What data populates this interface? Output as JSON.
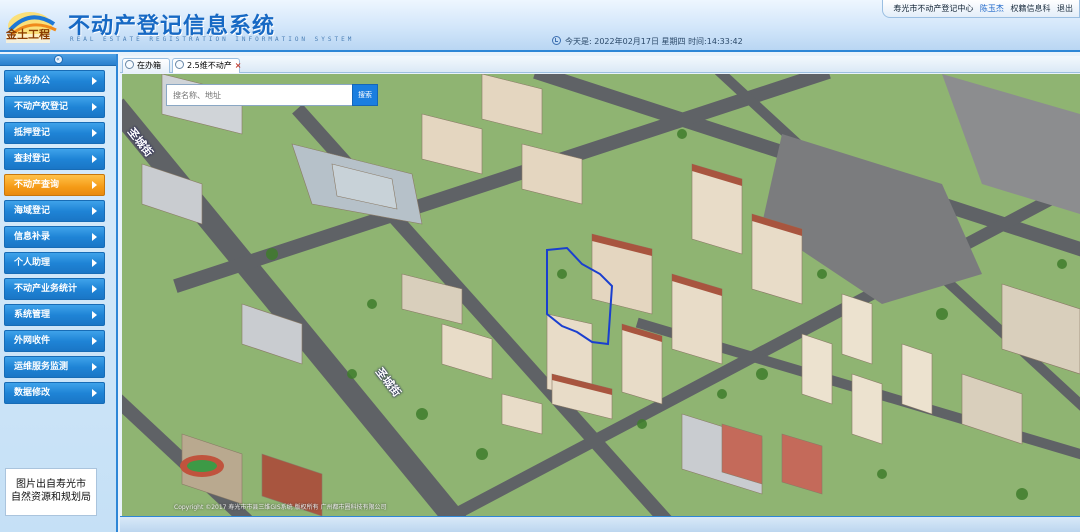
{
  "header": {
    "logo_text": "金土工程",
    "title": "不动产登记信息系统",
    "subtitle": "REAL ESTATE REGISTRATION INFORMATION SYSTEM",
    "center_name": "寿光市不动产登记中心",
    "user_name": "陈玉杰",
    "link_dept": "权籍信息科",
    "link_exit": "退出",
    "date_label": "今天是:",
    "date_value": "2022年02月17日",
    "weekday": "星期四",
    "time_label": "时间:",
    "time_value": "14:33:42"
  },
  "sidebar": {
    "collapse_label": "«",
    "items": [
      {
        "label": "业务办公"
      },
      {
        "label": "不动产权登记"
      },
      {
        "label": "抵押登记"
      },
      {
        "label": "查封登记"
      },
      {
        "label": "不动产查询"
      },
      {
        "label": "海域登记"
      },
      {
        "label": "信息补录"
      },
      {
        "label": "个人助理"
      },
      {
        "label": "不动产业务统计"
      },
      {
        "label": "系统管理"
      },
      {
        "label": "外网收件"
      },
      {
        "label": "运维服务监测"
      },
      {
        "label": "数据修改"
      }
    ],
    "active_index": 4,
    "credit_line1": "图片出自寿光市",
    "credit_line2": "自然资源和规划局"
  },
  "tabs": [
    {
      "label": "在办箱"
    },
    {
      "label": "2.5维不动产",
      "close": "×"
    }
  ],
  "map": {
    "search_placeholder": "搜名称、地址",
    "search_button": "搜索",
    "streets": [
      {
        "label": "圣城街"
      },
      {
        "label": "圣城街"
      }
    ],
    "copyright": "Copyright ©2017 寿光市市县三维GIS系统 版权所有 广州都市圈科技有限公司",
    "colors": {
      "grass": "#8fb472",
      "road": "#5f6266",
      "building": "#e8dcc8",
      "roof": "#a8553f",
      "highlight": "#1a3fcf"
    }
  }
}
